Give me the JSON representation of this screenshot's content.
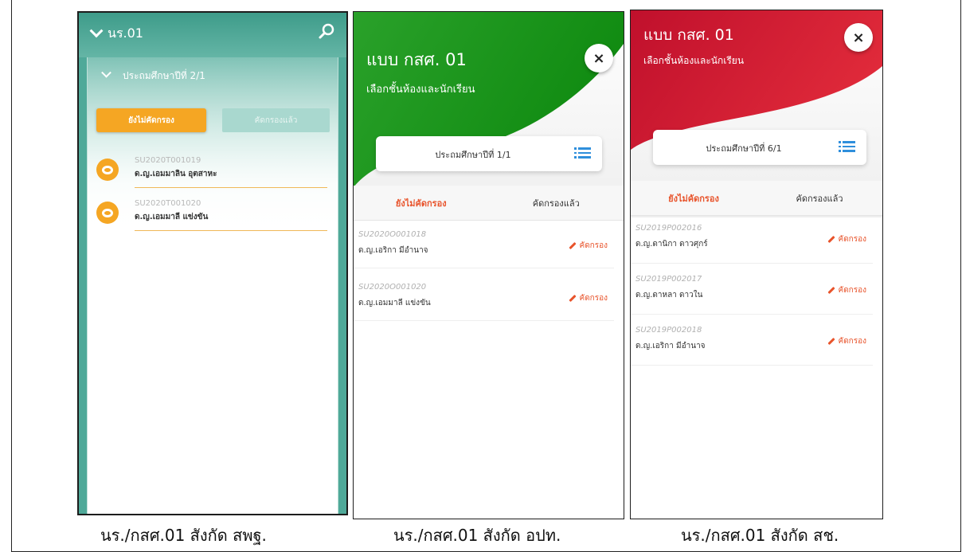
{
  "colors": {
    "teal": "#4fa999",
    "green": "#1fa51f",
    "red": "#c8102e",
    "orange": "#f5a623",
    "accent_text": "#e8542c",
    "list_icon_blue": "#2f8fdc"
  },
  "screens": [
    {
      "header": {
        "title": "นร.01",
        "search_icon": "search-icon"
      },
      "class_label": "ประถมศึกษาปีที่ 2/1",
      "tabs": {
        "pending": "ยังไม่คัดกรอง",
        "done": "คัดกรองแล้ว"
      },
      "students": [
        {
          "code": "SU2020T001019",
          "name": "ด.ญ.เอมมาลิน อุตสาหะ"
        },
        {
          "code": "SU2020T001020",
          "name": "ด.ญ.เอมมาลี แข่งขัน"
        }
      ],
      "caption": "นร./กสศ.01 สังกัด สพฐ."
    },
    {
      "title": "แบบ กสศ. 01",
      "subtitle": "เลือกชั้นห้องและนักเรียน",
      "close_icon": "close-icon",
      "class_selector": "ประถมศึกษาปีที่ 1/1",
      "tabs": {
        "pending": "ยังไม่คัดกรอง",
        "done": "คัดกรองแล้ว"
      },
      "students": [
        {
          "code": "SU2020O001018",
          "name": "ด.ญ.เอริกา มีอำนาจ",
          "action": "คัดกรอง"
        },
        {
          "code": "SU2020O001020",
          "name": "ด.ญ.เอมมาลี แข่งขัน",
          "action": "คัดกรอง"
        }
      ],
      "caption": "นร./กสศ.01 สังกัด อปท."
    },
    {
      "title": "แบบ กสศ. 01",
      "subtitle": "เลือกชั้นห้องและนักเรียน",
      "close_icon": "close-icon",
      "class_selector": "ประถมศึกษาปีที่ 6/1",
      "tabs": {
        "pending": "ยังไม่คัดกรอง",
        "done": "คัดกรองแล้ว"
      },
      "students": [
        {
          "code": "SU2019P002016",
          "name": "ด.ญ.ดานิกา ดาวศุกร์",
          "action": "คัดกรอง"
        },
        {
          "code": "SU2019P002017",
          "name": "ด.ญ.ดาหลา ดาวใน",
          "action": "คัดกรอง"
        },
        {
          "code": "SU2019P002018",
          "name": "ด.ญ.เอริกา มีอำนาจ",
          "action": "คัดกรอง"
        }
      ],
      "caption": "นร./กสศ.01 สังกัด สช."
    }
  ]
}
